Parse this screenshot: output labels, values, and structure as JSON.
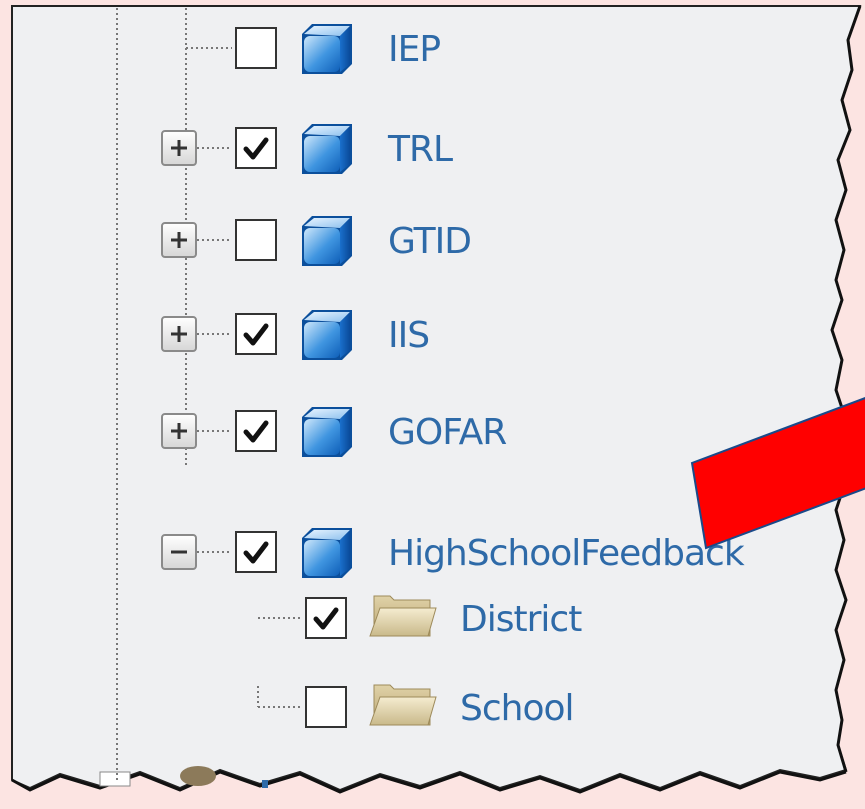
{
  "tree": {
    "nodes": [
      {
        "label": "IEP",
        "checked": false,
        "expander": "none",
        "icon": "cube-icon"
      },
      {
        "label": "TRL",
        "checked": true,
        "expander": "plus",
        "icon": "cube-icon"
      },
      {
        "label": "GTID",
        "checked": false,
        "expander": "plus",
        "icon": "cube-icon"
      },
      {
        "label": "IIS",
        "checked": true,
        "expander": "plus",
        "icon": "cube-icon"
      },
      {
        "label": "GOFAR",
        "checked": true,
        "expander": "plus",
        "icon": "cube-icon"
      },
      {
        "label": "HighSchoolFeedback",
        "checked": true,
        "expander": "minus",
        "icon": "cube-icon"
      }
    ],
    "children": [
      {
        "label": "District",
        "checked": true,
        "icon": "folder-icon"
      },
      {
        "label": "School",
        "checked": false,
        "icon": "folder-icon"
      }
    ]
  },
  "annotation": {
    "type": "arrow",
    "color": "#ff0000",
    "points_to": "HighSchoolFeedback"
  },
  "colors": {
    "panel": "#eff0f2",
    "label_text": "#2e6aa8",
    "frame_background": "#fce4e2",
    "arrow": "#ff0000"
  }
}
